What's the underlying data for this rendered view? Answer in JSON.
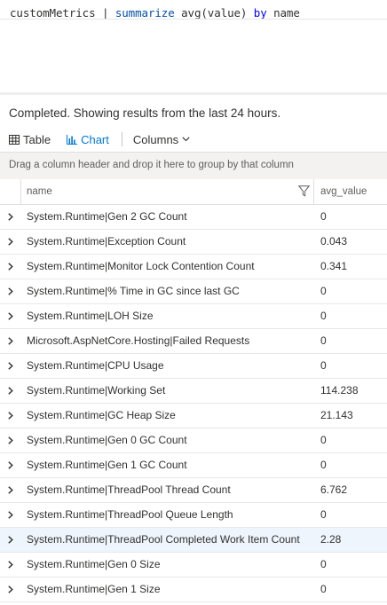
{
  "query": {
    "table": "customMetrics",
    "pipe": " | ",
    "operator": "summarize",
    "expression": " avg(value) ",
    "by": "by",
    "group_field": " name"
  },
  "status": "Completed. Showing results from the last 24 hours.",
  "tabs": {
    "table_label": "Table",
    "chart_label": "Chart",
    "columns_label": "Columns",
    "active": "Table"
  },
  "group_bar": "Drag a column header and drop it here to group by that column",
  "columns": {
    "name": "name",
    "value": "avg_value"
  },
  "rows": [
    {
      "name": "System.Runtime|Gen 2 GC Count",
      "value": "0"
    },
    {
      "name": "System.Runtime|Exception Count",
      "value": "0.043"
    },
    {
      "name": "System.Runtime|Monitor Lock Contention Count",
      "value": "0.341"
    },
    {
      "name": "System.Runtime|% Time in GC since last GC",
      "value": "0"
    },
    {
      "name": "System.Runtime|LOH Size",
      "value": "0"
    },
    {
      "name": "Microsoft.AspNetCore.Hosting|Failed Requests",
      "value": "0"
    },
    {
      "name": "System.Runtime|CPU Usage",
      "value": "0"
    },
    {
      "name": "System.Runtime|Working Set",
      "value": "114.238"
    },
    {
      "name": "System.Runtime|GC Heap Size",
      "value": "21.143"
    },
    {
      "name": "System.Runtime|Gen 0 GC Count",
      "value": "0"
    },
    {
      "name": "System.Runtime|Gen 1 GC Count",
      "value": "0"
    },
    {
      "name": "System.Runtime|ThreadPool Thread Count",
      "value": "6.762"
    },
    {
      "name": "System.Runtime|ThreadPool Queue Length",
      "value": "0"
    },
    {
      "name": "System.Runtime|ThreadPool Completed Work Item Count",
      "value": "2.28"
    },
    {
      "name": "System.Runtime|Gen 0 Size",
      "value": "0"
    },
    {
      "name": "System.Runtime|Gen 1 Size",
      "value": "0"
    }
  ],
  "highlighted_row": 13,
  "colors": {
    "accent": "#0078d4",
    "keyword_function": "#0451a5",
    "keyword_by": "#0000ff",
    "row_highlight": "#eef5fc"
  },
  "icons": {
    "table_tab": "table-grid-icon",
    "chart_tab": "bar-chart-icon",
    "columns_dropdown": "chevron-down-icon",
    "header_filter": "filter-icon",
    "row_expand": "chevron-right-icon"
  }
}
